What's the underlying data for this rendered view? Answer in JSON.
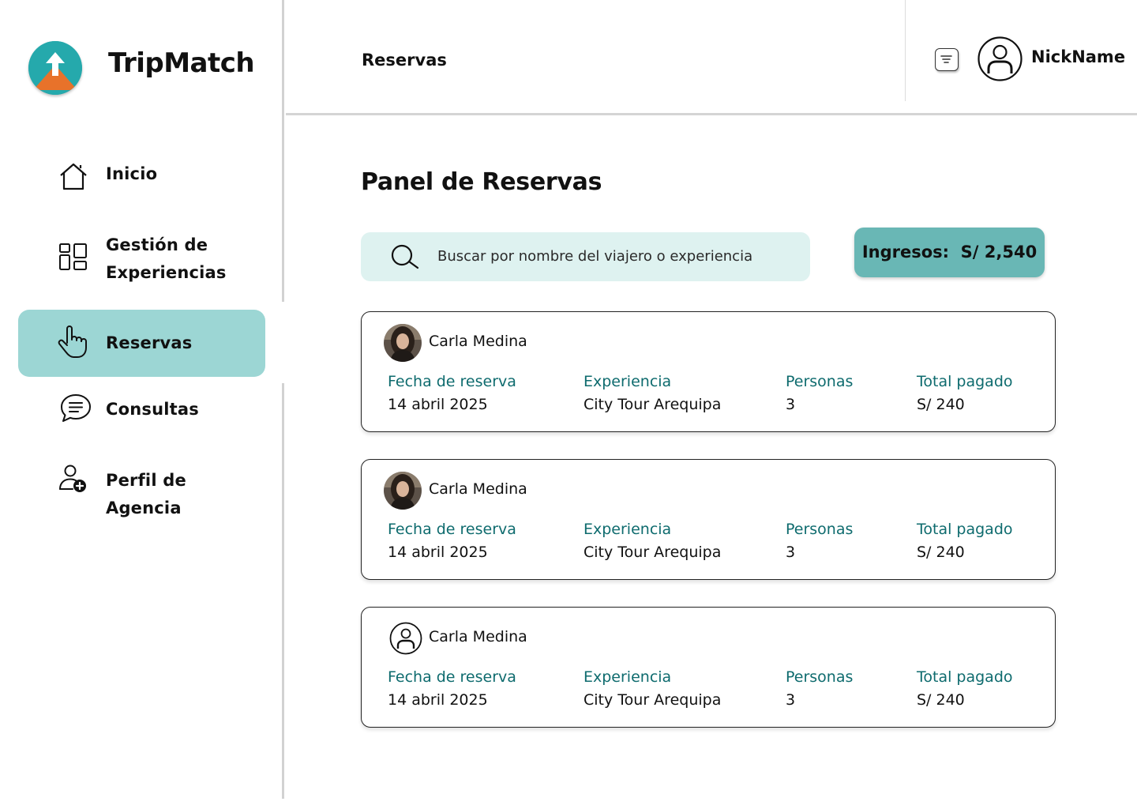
{
  "app": {
    "brand": "TripMatch",
    "accent": "#9cd6d4",
    "label_color": "#0e6b6e",
    "badge_color": "#69b7b5",
    "logo_icon": "arrow-up-mountain-logo"
  },
  "sidebar": {
    "items": [
      {
        "label": "Inicio",
        "icon": "home-icon",
        "active": false
      },
      {
        "label": "Gestión de Experiencias",
        "line1": "Gestión de",
        "line2": "Experiencias",
        "icon": "grid-icon",
        "active": false
      },
      {
        "label": "Reservas",
        "icon": "hand-pointer-icon",
        "active": true
      },
      {
        "label": "Consultas",
        "icon": "chat-bubble-icon",
        "active": false
      },
      {
        "label": "Perfil de Agencia",
        "icon": "user-add-icon",
        "active": false
      }
    ]
  },
  "header": {
    "title": "Reservas",
    "filter_icon": "filter-icon",
    "user_icon": "user-circle-icon",
    "nickname": "NickName"
  },
  "main": {
    "title": "Panel de Reservas",
    "search": {
      "placeholder": "Buscar por nombre del viajero o experiencia"
    },
    "income": {
      "label": "Ingresos:",
      "value": "S/ 2,540",
      "text": "Ingresos:  S/ 2,540"
    },
    "columns": {
      "date": "Fecha de reserva",
      "experience": "Experiencia",
      "people": "Personas",
      "total": "Total pagado"
    },
    "reservations": [
      {
        "name": "Carla Medina",
        "avatar": "photo",
        "date": "14 abril 2025",
        "experience": "City Tour Arequipa",
        "people": "3",
        "total": "S/ 240"
      },
      {
        "name": "Carla Medina",
        "avatar": "photo",
        "date": "14 abril 2025",
        "experience": "City Tour Arequipa",
        "people": "3",
        "total": "S/ 240"
      },
      {
        "name": "Carla Medina",
        "avatar": "user-icon",
        "date": "14 abril 2025",
        "experience": "City Tour Arequipa",
        "people": "3",
        "total": "S/ 240"
      }
    ]
  }
}
